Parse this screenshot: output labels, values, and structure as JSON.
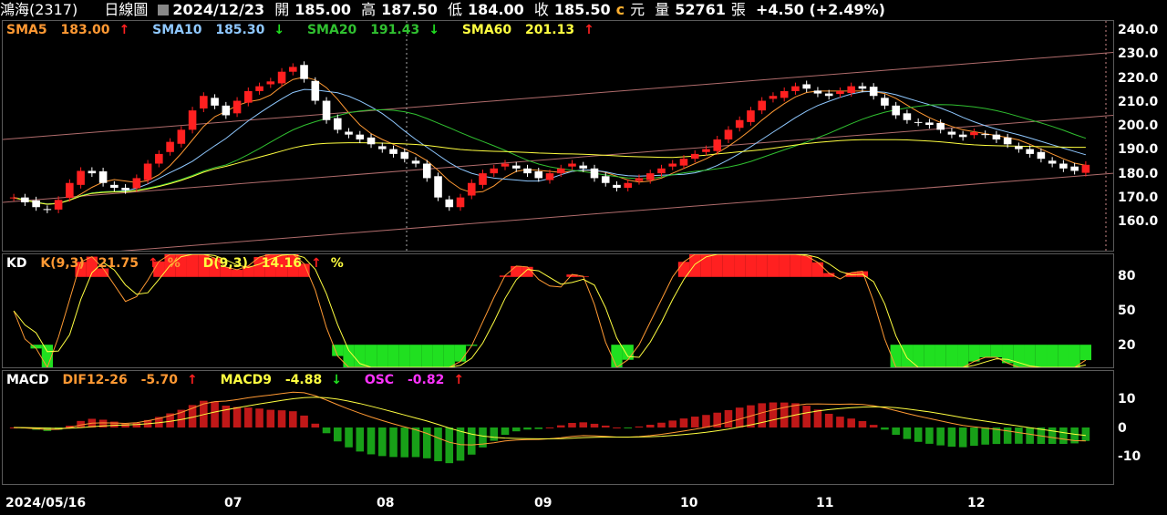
{
  "header": {
    "name": "鴻海(2317)",
    "period": "日線圖",
    "date": "2024/12/23",
    "open_label": "開",
    "open": "185.00",
    "high_label": "高",
    "high": "187.50",
    "low_label": "低",
    "low": "184.00",
    "close_label": "收",
    "close": "185.50",
    "close_unit": "元",
    "close_flag": "c",
    "vol_label": "量",
    "volume": "52761",
    "vol_unit": "張",
    "change": "+4.50 (+2.49%)"
  },
  "legends": {
    "sma5": {
      "label": "SMA5",
      "value": "183.00",
      "arrow": "↑",
      "color": "#ff9933"
    },
    "sma10": {
      "label": "SMA10",
      "value": "185.30",
      "arrow": "↓",
      "color": "#8fc8ff"
    },
    "sma20": {
      "label": "SMA20",
      "value": "191.43",
      "arrow": "↓",
      "color": "#30c030"
    },
    "sma60": {
      "label": "SMA60",
      "value": "201.13",
      "arrow": "↑",
      "color": "#ffff40"
    },
    "kd_title": "KD",
    "k": {
      "label": "K(9,3)",
      "value": "21.75",
      "arrow": "↑",
      "unit": "%",
      "color": "#ff9933"
    },
    "d": {
      "label": "D(9,3)",
      "value": "14.16",
      "arrow": "↑",
      "unit": "%",
      "color": "#ffff40"
    },
    "macd_title": "MACD",
    "dif": {
      "label": "DIF12-26",
      "value": "-5.70",
      "arrow": "↑",
      "color": "#ff9933"
    },
    "macd9": {
      "label": "MACD9",
      "value": "-4.88",
      "arrow": "↓",
      "color": "#ffff40"
    },
    "osc": {
      "label": "OSC",
      "value": "-0.82",
      "arrow": "↑",
      "color": "#ff33ff"
    }
  },
  "axes": {
    "price_ticks": [
      "240.0",
      "230.0",
      "220.0",
      "210.0",
      "200.0",
      "190.0",
      "180.0",
      "170.0",
      "160.0"
    ],
    "kd_ticks": [
      "80",
      "50",
      "20"
    ],
    "macd_ticks": [
      "10",
      "0",
      "-10"
    ],
    "x_ticks": [
      "2024/05/16",
      "07",
      "08",
      "09",
      "10",
      "11",
      "12"
    ]
  },
  "chart_data": {
    "type": "candlestick",
    "series_close": [
      172,
      170,
      168,
      167,
      171,
      178,
      183,
      182,
      178,
      176,
      175,
      180,
      186,
      190,
      195,
      200,
      208,
      214,
      210,
      206,
      212,
      216,
      218,
      220,
      224,
      226,
      221,
      212,
      204,
      200,
      198,
      196,
      194,
      192,
      190,
      188,
      186,
      180,
      172,
      168,
      172,
      178,
      182,
      184,
      186,
      184,
      182,
      180,
      182,
      184,
      186,
      184,
      180,
      178,
      176,
      178,
      180,
      182,
      184,
      186,
      188,
      190,
      192,
      196,
      200,
      204,
      208,
      212,
      214,
      216,
      218,
      217,
      215,
      214,
      216,
      218,
      217,
      214,
      210,
      206,
      204,
      203,
      202,
      200,
      198,
      197,
      199,
      198,
      196,
      194,
      192,
      190,
      188,
      186,
      184,
      183,
      185.5
    ],
    "sma60_end": 201.13,
    "last_close": 185.5,
    "ylim": [
      150,
      245
    ]
  },
  "colors": {
    "up": "#ff2020",
    "down": "#ffffff",
    "grid": "#5a5a5a"
  }
}
